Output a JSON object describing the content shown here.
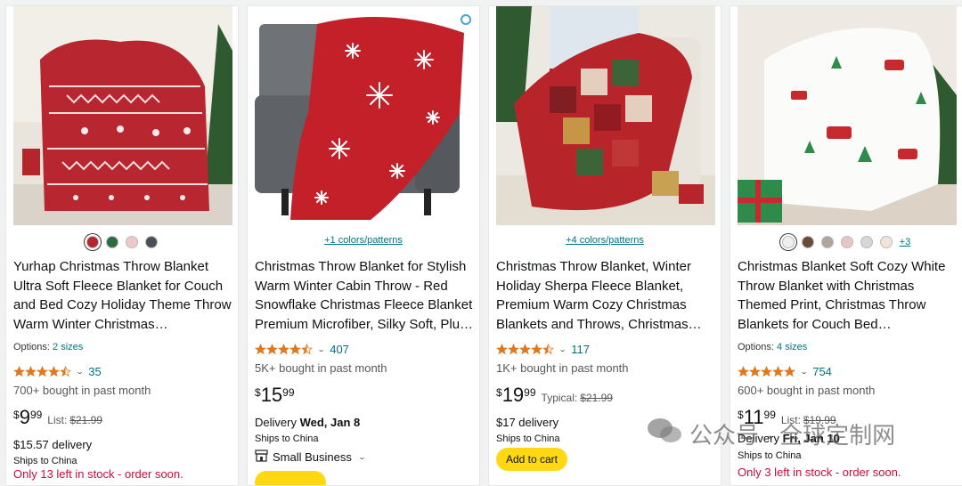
{
  "products": [
    {
      "title": "Yurhap Christmas Throw Blanket Ultra Soft Fleece Blanket for Couch and Bed Cozy Holiday Theme Throw Warm Winter Christmas Decoration…",
      "swatches": [
        "#b5262b",
        "#2d6a3f",
        "#f1c6c9",
        "#4c4f57"
      ],
      "options_label": "Options:",
      "options_link": "2 sizes",
      "rating_stars": 4.5,
      "rating_count": "35",
      "bought": "700+ bought in past month",
      "price_sym": "$",
      "price_whole": "9",
      "price_frac": "99",
      "price_list_label": "List:",
      "price_list": "$21.99",
      "delivery": "$15.57 delivery",
      "ships": "Ships to China",
      "stock": "Only 13 left in stock - order soon."
    },
    {
      "title": "Christmas Throw Blanket for Stylish Warm Winter Cabin Throw - Red Snowflake Christmas Fleece Blanket Premium Microfiber, Silky Soft, Plu…",
      "colors_link": "+1 colors/patterns",
      "rating_stars": 4.5,
      "rating_count": "407",
      "bought": "5K+ bought in past month",
      "price_sym": "$",
      "price_whole": "15",
      "price_frac": "99",
      "delivery_label": "Delivery",
      "delivery_date": "Wed, Jan 8",
      "ships": "Ships to China",
      "small_business": "Small Business"
    },
    {
      "title": "Christmas Throw Blanket, Winter Holiday Sherpa Fleece Blanket, Premium Warm Cozy Christmas Blankets and Throws, Christmas…",
      "colors_link": "+4 colors/patterns",
      "rating_stars": 4.5,
      "rating_count": "117",
      "bought": "1K+ bought in past month",
      "price_sym": "$",
      "price_whole": "19",
      "price_frac": "99",
      "price_list_label": "Typical:",
      "price_list": "$21.99",
      "delivery": "$17 delivery",
      "ships": "Ships to China",
      "cart_label": "Add to cart"
    },
    {
      "title": "Christmas Blanket Soft Cozy White Throw Blanket with Christmas Themed Print, Christmas Throw Blankets for Couch Bed Decoration…",
      "swatches": [
        "#efefef",
        "#6b4a3a",
        "#b2a49a",
        "#e9c3c6",
        "#d6d6d6",
        "#efe4dc"
      ],
      "swatch_more": "+3",
      "options_label": "Options:",
      "options_link": "4 sizes",
      "rating_stars": 5,
      "rating_count": "754",
      "bought": "600+ bought in past month",
      "price_sym": "$",
      "price_whole": "11",
      "price_frac": "99",
      "price_list_label": "List:",
      "price_list": "$19.99",
      "delivery_label": "Delivery",
      "delivery_date": "Fri, Jan 10",
      "ships": "Ships to China",
      "stock": "Only 3 left in stock - order soon."
    }
  ],
  "watermark": "公众号 · 全球定制网",
  "colors": {
    "star": "#de7921",
    "link": "#007185",
    "cart": "#ffd814"
  }
}
